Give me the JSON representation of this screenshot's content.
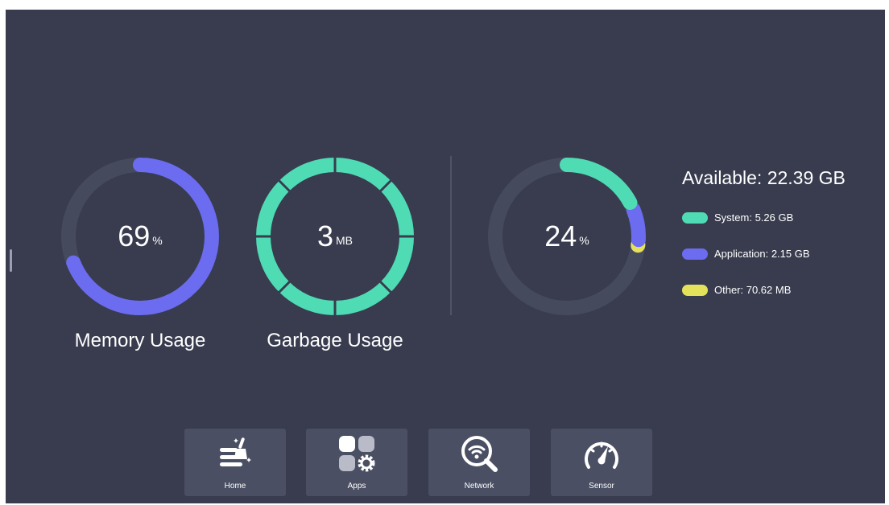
{
  "memory": {
    "value": "69",
    "unit": "%",
    "title": "Memory Usage",
    "fraction": 0.69
  },
  "garbage": {
    "value": "3",
    "unit": "MB",
    "title": "Garbage Usage"
  },
  "storage": {
    "value": "24",
    "unit": "%",
    "available_label": "Available: 22.39 GB",
    "legend": [
      {
        "label": "System: 5.26 GB",
        "color": "#4fdcb4"
      },
      {
        "label": "Application: 2.15 GB",
        "color": "#6b6cf0"
      },
      {
        "label": "Other: 70.62 MB",
        "color": "#e4e15a"
      }
    ]
  },
  "colors": {
    "background": "#383c4e",
    "track": "#464a5d",
    "memory": "#6b6cf0",
    "garbage": "#4fdcb4",
    "button": "#4a4f63"
  },
  "dock": [
    {
      "label": "Home",
      "icon": "clean-broom-icon"
    },
    {
      "label": "Apps",
      "icon": "apps-grid-gear-icon"
    },
    {
      "label": "Network",
      "icon": "wifi-search-icon"
    },
    {
      "label": "Sensor",
      "icon": "speedometer-icon"
    }
  ]
}
